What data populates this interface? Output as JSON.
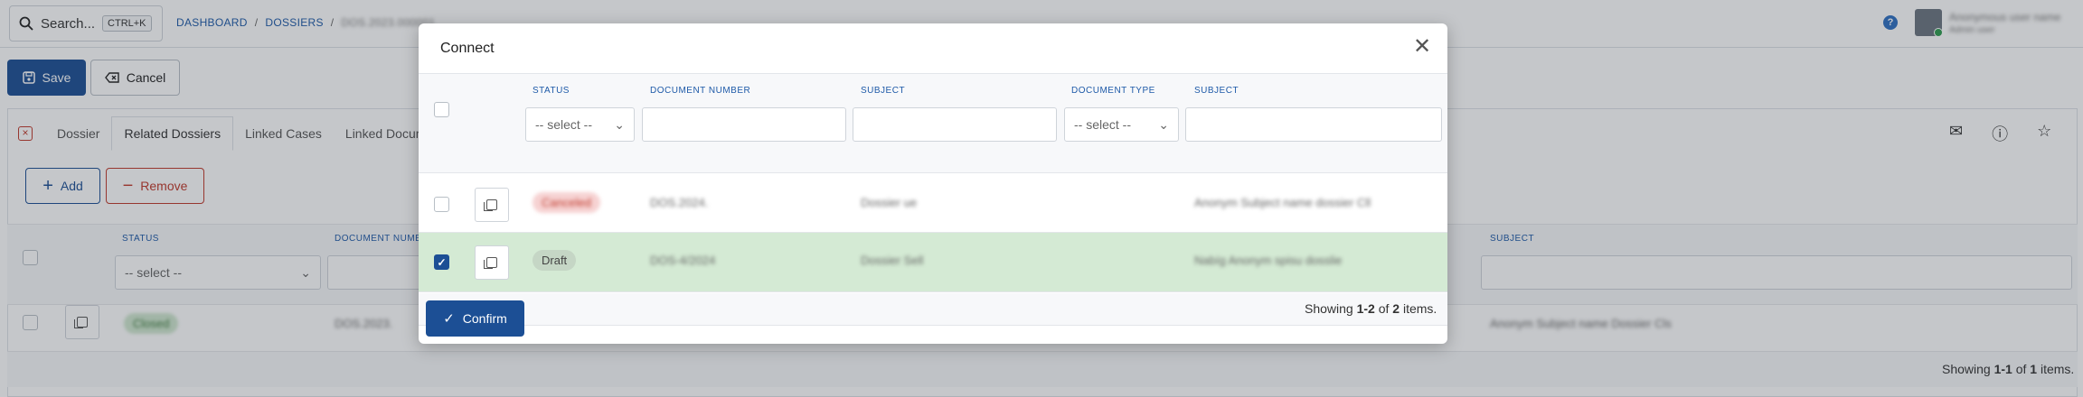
{
  "topbar": {
    "search_label": "Search...",
    "search_shortcut": "CTRL+K",
    "breadcrumb": [
      "DASHBOARD",
      "DOSSIERS",
      "DOS.2023.000001"
    ],
    "user_name": "Anonymous user name",
    "user_role": "Admin user"
  },
  "toolbar": {
    "save_label": "Save",
    "cancel_label": "Cancel"
  },
  "tabs": [
    "Dossier",
    "Related Dossiers",
    "Linked Cases",
    "Linked Docum"
  ],
  "actions": {
    "add_label": "Add",
    "remove_label": "Remove"
  },
  "bg_table": {
    "columns": {
      "status": "STATUS",
      "document_number": "DOCUMENT NUMB",
      "subject": "SUBJECT"
    },
    "status_placeholder": "-- select --",
    "row": {
      "status": "Closed",
      "number": "DOS.2023.",
      "subject": "Anonym Subject name Dossier Cls"
    },
    "footer": {
      "prefix": "Showing",
      "range": "1-1",
      "of": "of",
      "total": "1",
      "suffix": "items."
    }
  },
  "modal": {
    "title": "Connect",
    "columns": {
      "status": "STATUS",
      "document_number": "DOCUMENT NUMBER",
      "subject": "SUBJECT",
      "document_type": "DOCUMENT TYPE",
      "subject2": "SUBJECT"
    },
    "select_placeholder": "-- select --",
    "doc_type_placeholder": "-- select --",
    "rows": [
      {
        "status": "Canceled",
        "number": "DOS.2024.",
        "subject": "Dossier ue",
        "subject2": "Anonym Subject name dossier Cll",
        "selected": false
      },
      {
        "status": "Draft",
        "number": "DOS-4/2024",
        "subject": "Dossier Sell",
        "subject2": "Nabíg Anonym spisu dosslie",
        "selected": true
      }
    ],
    "footer": {
      "prefix": "Showing",
      "range": "1-2",
      "of": "of",
      "total": "2",
      "suffix": "items."
    },
    "confirm_label": "Confirm"
  },
  "colors": {
    "primary": "#1c4f95",
    "danger": "#c0392b",
    "selected_row": "#d4ead4"
  }
}
